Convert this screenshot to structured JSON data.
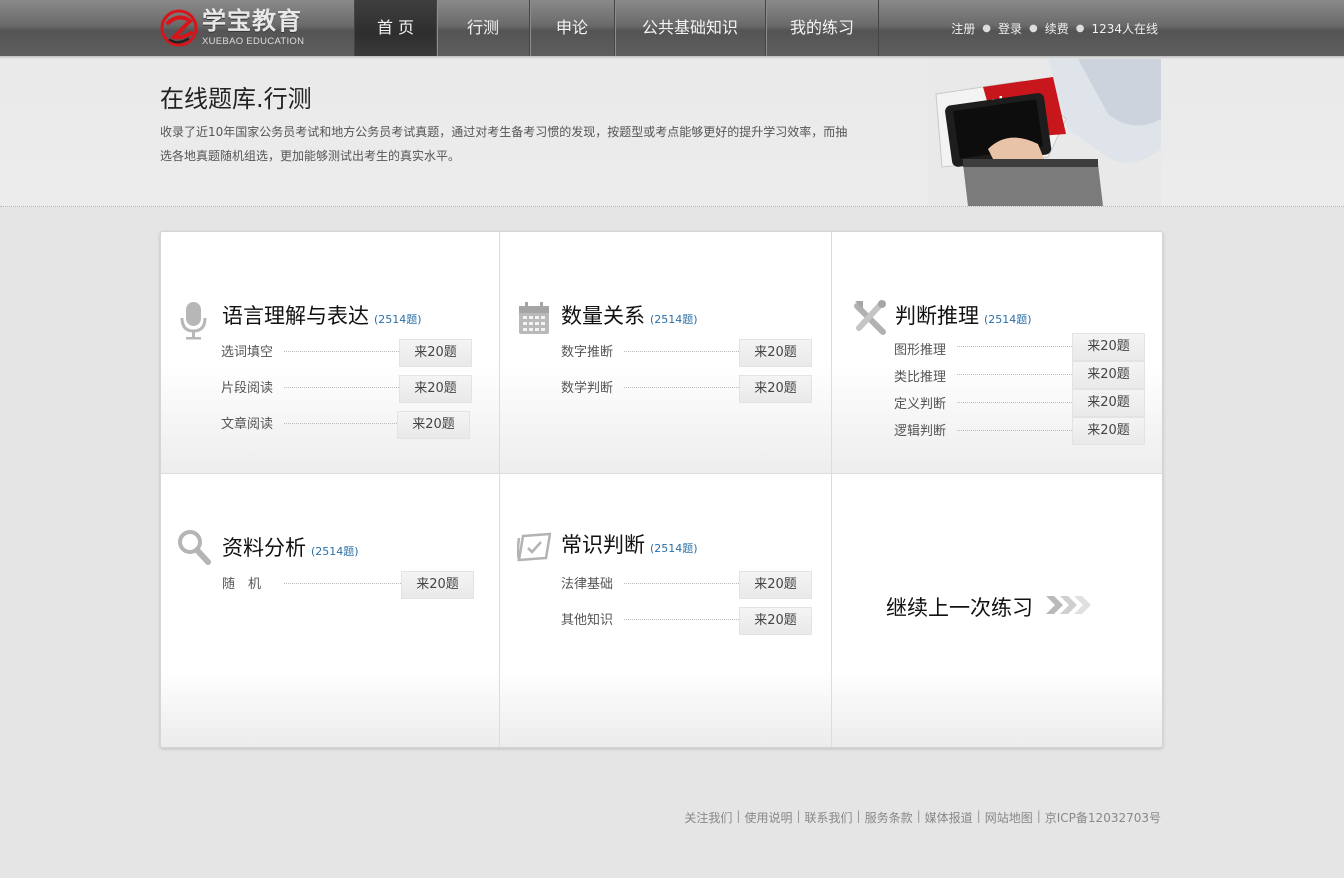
{
  "header": {
    "logo": {
      "cn": "学宝教育",
      "en": "XUEBAO EDUCATION"
    },
    "nav": [
      {
        "label": "首 页",
        "active": true
      },
      {
        "label": "行测"
      },
      {
        "label": "申论"
      },
      {
        "label": "公共基础知识"
      },
      {
        "label": "我的练习"
      }
    ],
    "user_links": {
      "register": "注册",
      "login": "登录",
      "renew": "续费",
      "online": "1234人在线"
    }
  },
  "banner": {
    "title": "在线题库.行测",
    "description": "收录了近10年国家公务员考试和地方公务员考试真题，通过对考生备考习惯的发现，按题型或考点能够更好的提升学习效率，而抽选各地真题随机组选，更加能够测试出考生的真实水平。"
  },
  "categories": [
    {
      "title": "语言理解与表达",
      "count": "(2514题)",
      "icon": "microphone-icon",
      "items": [
        {
          "label": "选词填空",
          "button": "来20题"
        },
        {
          "label": "片段阅读",
          "button": "来20题"
        },
        {
          "label": "文章阅读",
          "button": "来20题"
        }
      ]
    },
    {
      "title": "数量关系",
      "count": "(2514题)",
      "icon": "calendar-icon",
      "items": [
        {
          "label": "数字推断",
          "button": "来20题"
        },
        {
          "label": "数学判断",
          "button": "来20题"
        }
      ]
    },
    {
      "title": "判断推理",
      "count": "(2514题)",
      "icon": "tools-icon",
      "items": [
        {
          "label": "图形推理",
          "button": "来20题"
        },
        {
          "label": "类比推理",
          "button": "来20题"
        },
        {
          "label": "定义判断",
          "button": "来20题"
        },
        {
          "label": "逻辑判断",
          "button": "来20题"
        }
      ]
    },
    {
      "title": "资料分析",
      "count": "(2514题)",
      "icon": "magnifier-icon",
      "items": [
        {
          "label": "随　机",
          "button": "来20题"
        }
      ]
    },
    {
      "title": "常识判断",
      "count": "(2514题)",
      "icon": "notepad-check-icon",
      "items": [
        {
          "label": "法律基础",
          "button": "来20题"
        },
        {
          "label": "其他知识",
          "button": "来20题"
        }
      ]
    }
  ],
  "continue_label": "继续上一次练习",
  "footer": {
    "links": [
      "关注我们",
      "使用说明",
      "联系我们",
      "服务条款",
      "媒体报道",
      "网站地图"
    ],
    "icp": "京ICP备12032703号"
  },
  "colors": {
    "accent_red": "#d7141a",
    "count_blue": "#2a6fa8",
    "nav_active": "#333333"
  }
}
